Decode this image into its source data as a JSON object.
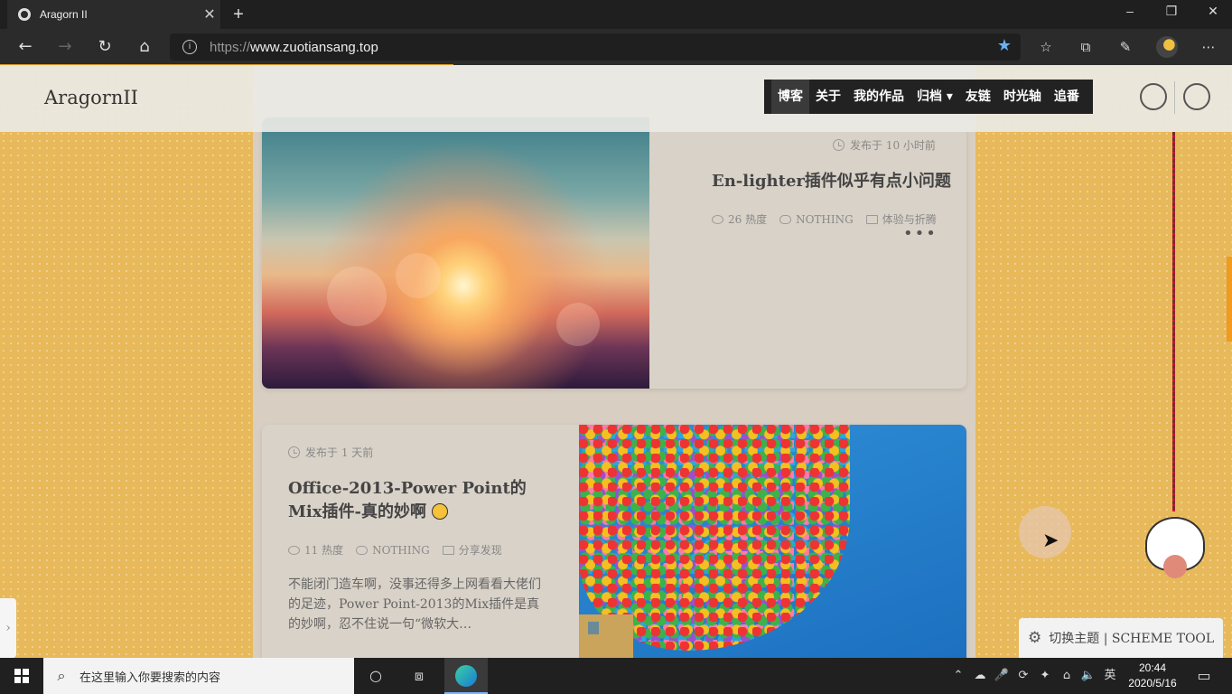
{
  "browser": {
    "tab_title": "Aragorn II",
    "tab_close": "✕",
    "new_tab": "+",
    "url_protocol": "https://",
    "url_host": "www.zuotiansang.top",
    "window_min": "–",
    "window_restore": "❐",
    "window_close": "✕"
  },
  "site": {
    "logo": "AragornII",
    "menu": [
      "博客",
      "关于",
      "我的作品",
      "归档 ▾",
      "友链",
      "时光轴",
      "追番"
    ]
  },
  "posts": [
    {
      "date": "发布于 10 小时前",
      "title": "En-lighter插件似乎有点小问题",
      "views": "26 热度",
      "comments": "NOTHING",
      "category": "体验与折腾",
      "more": "•••"
    },
    {
      "date": "发布于 1 天前",
      "title": "Office-2013-Power Point的Mix插件-真的妙啊",
      "views": "11 热度",
      "comments": "NOTHING",
      "category": "分享发现",
      "excerpt": "不能闭门造车啊，没事还得多上网看看大佬们的足迹，Power Point-2013的Mix插件是真的妙啊，忍不住说一句“微软大…"
    }
  ],
  "scheme_tool": "切换主题 | SCHEME TOOL",
  "taskbar": {
    "search_placeholder": "在这里输入你要搜索的内容",
    "ime": "英",
    "time": "20:44",
    "date": "2020/5/16"
  }
}
